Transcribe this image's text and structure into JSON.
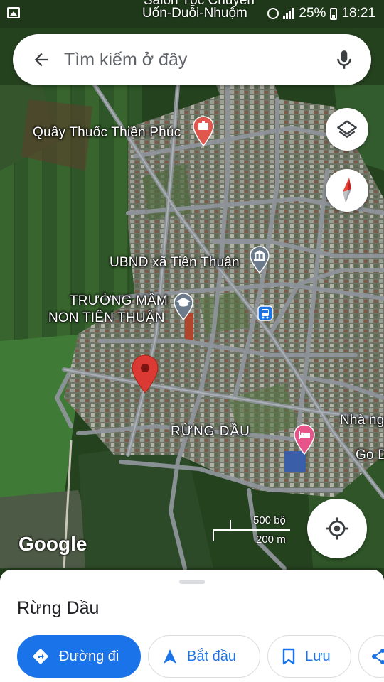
{
  "status_bar": {
    "top_label_line1": "Salon Tóc Chuyên",
    "top_label_line2": "Uốn-Duỗi-Nhuộm",
    "battery": "25%",
    "time": "18:21"
  },
  "search": {
    "placeholder": "Tìm kiếm ở đây"
  },
  "map": {
    "labels": {
      "pharmacy": "Quầy Thuốc Thiên Phúc",
      "committee": "UBND xã Tiên Thuận",
      "school_line1": "TRƯỜNG MẦM",
      "school_line2": "NON TIÊN THUẬN",
      "area": "RỪNG DẦU",
      "right_1": "Nhà ng",
      "right_2": "Go D"
    },
    "scale": {
      "imperial": "500 bộ",
      "metric": "200 m"
    },
    "logo": "Google"
  },
  "bottom_sheet": {
    "title": "Rừng Dầu",
    "actions": {
      "directions": "Đường đi",
      "start": "Bắt đầu",
      "save": "Lưu"
    }
  },
  "colors": {
    "accent": "#1a73e8",
    "marker_red": "#db3a34",
    "pharmacy_marker": "#e0574d",
    "lodging_marker": "#e8548a",
    "poi_gray": "#6b7b8c"
  }
}
